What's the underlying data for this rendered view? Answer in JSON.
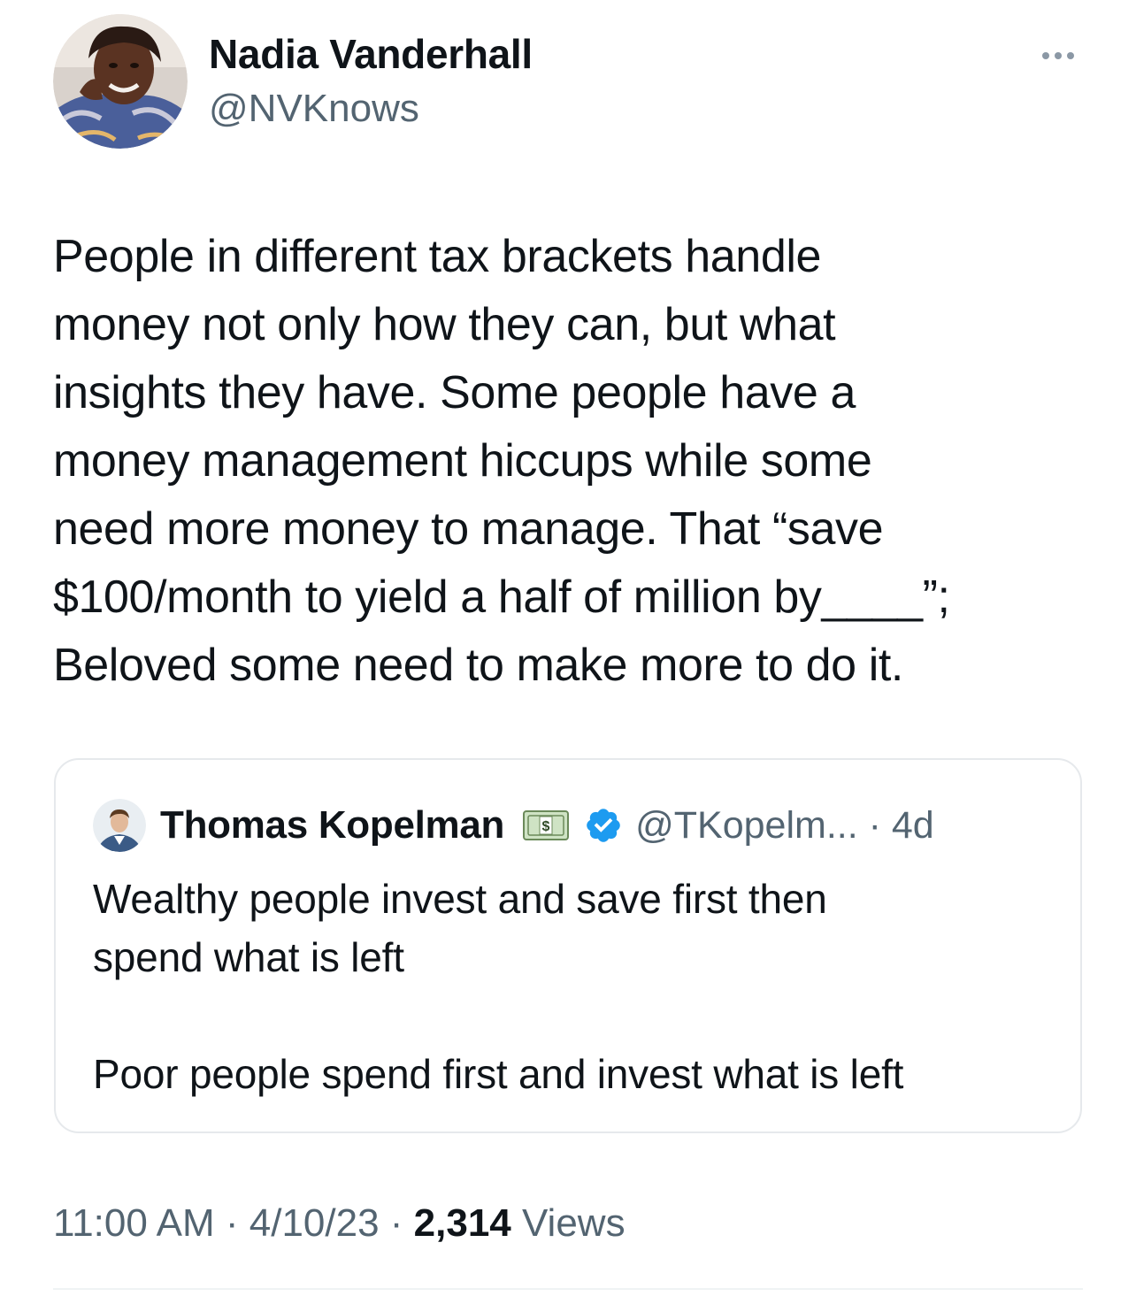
{
  "author": {
    "name": "Nadia Vanderhall",
    "handle": "@NVKnows"
  },
  "tweet": {
    "text": "People in different tax brackets handle\nmoney not only how they can, but what\ninsights they have. Some people have a\nmoney management hiccups while some\nneed more money to manage. That “save\n$100/month to yield a half of million by____”;\nBeloved  some need to make more to do it."
  },
  "quote": {
    "name": "Thomas Kopelman",
    "name_emoji": "dollar-banknote-icon",
    "verified": true,
    "handle_time": "@TKopelm... · 4d",
    "text": "Wealthy people invest and save first then\nspend what is left\n\nPoor people spend first and invest what is left"
  },
  "meta": {
    "time": "11:00 AM",
    "sep1": " · ",
    "date": "4/10/23",
    "sep2": " · ",
    "views_count": "2,314",
    "views_label": " Views"
  },
  "colors": {
    "text_primary": "#0f1419",
    "text_secondary": "#536471",
    "verified_blue": "#1d9bf0",
    "border": "#e6e9ec"
  }
}
